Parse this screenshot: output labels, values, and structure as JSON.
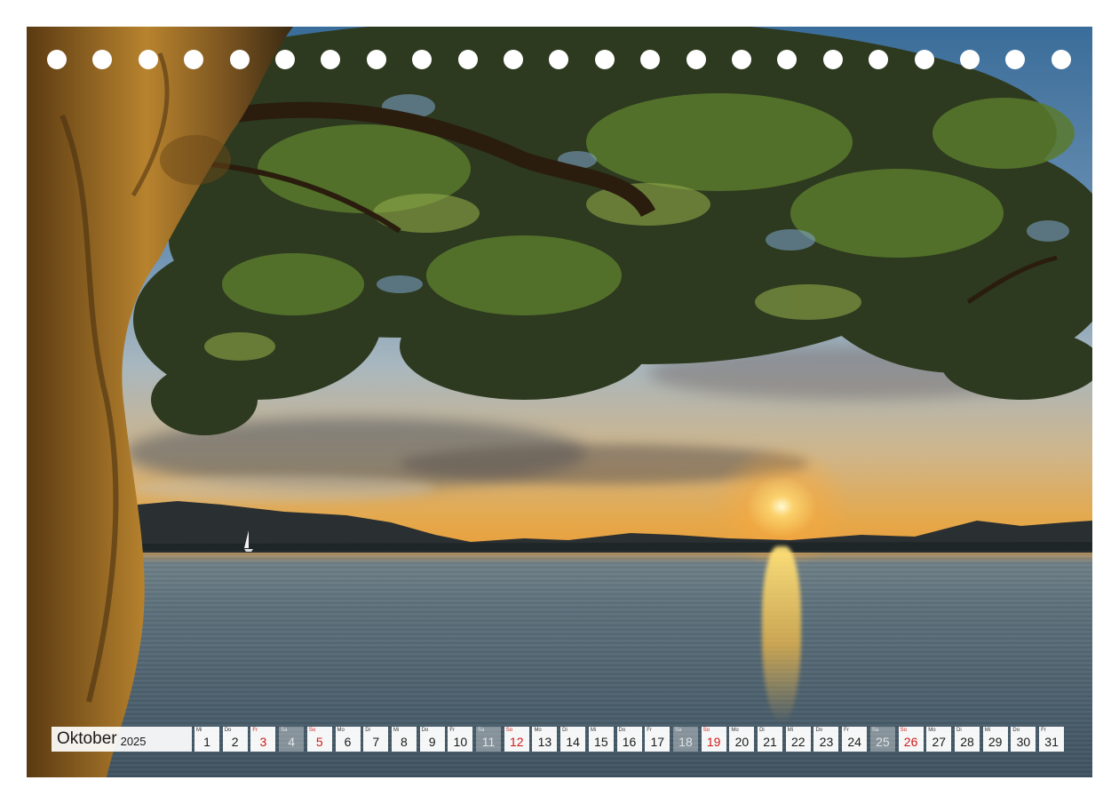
{
  "calendar": {
    "month": "Oktober",
    "year": "2025",
    "colors": {
      "sunday": "#d11a1a",
      "text": "#1a1a1a"
    },
    "days": [
      {
        "dow": "Mi",
        "num": "1",
        "style": "normal"
      },
      {
        "dow": "Do",
        "num": "2",
        "style": "normal"
      },
      {
        "dow": "Fr",
        "num": "3",
        "style": "red"
      },
      {
        "dow": "Sa",
        "num": "4",
        "style": "faded"
      },
      {
        "dow": "So",
        "num": "5",
        "style": "red"
      },
      {
        "dow": "Mo",
        "num": "6",
        "style": "normal"
      },
      {
        "dow": "Di",
        "num": "7",
        "style": "normal"
      },
      {
        "dow": "Mi",
        "num": "8",
        "style": "normal"
      },
      {
        "dow": "Do",
        "num": "9",
        "style": "normal"
      },
      {
        "dow": "Fr",
        "num": "10",
        "style": "normal"
      },
      {
        "dow": "Sa",
        "num": "11",
        "style": "faded"
      },
      {
        "dow": "So",
        "num": "12",
        "style": "red"
      },
      {
        "dow": "Mo",
        "num": "13",
        "style": "normal"
      },
      {
        "dow": "Di",
        "num": "14",
        "style": "normal"
      },
      {
        "dow": "Mi",
        "num": "15",
        "style": "normal"
      },
      {
        "dow": "Do",
        "num": "16",
        "style": "normal"
      },
      {
        "dow": "Fr",
        "num": "17",
        "style": "normal"
      },
      {
        "dow": "Sa",
        "num": "18",
        "style": "faded"
      },
      {
        "dow": "So",
        "num": "19",
        "style": "red"
      },
      {
        "dow": "Mo",
        "num": "20",
        "style": "normal"
      },
      {
        "dow": "Di",
        "num": "21",
        "style": "normal"
      },
      {
        "dow": "Mi",
        "num": "22",
        "style": "normal"
      },
      {
        "dow": "Do",
        "num": "23",
        "style": "normal"
      },
      {
        "dow": "Fr",
        "num": "24",
        "style": "normal"
      },
      {
        "dow": "Sa",
        "num": "25",
        "style": "faded"
      },
      {
        "dow": "So",
        "num": "26",
        "style": "red"
      },
      {
        "dow": "Mo",
        "num": "27",
        "style": "normal"
      },
      {
        "dow": "Di",
        "num": "28",
        "style": "normal"
      },
      {
        "dow": "Mi",
        "num": "29",
        "style": "normal"
      },
      {
        "dow": "Do",
        "num": "30",
        "style": "normal"
      },
      {
        "dow": "Fr",
        "num": "31",
        "style": "normal"
      }
    ]
  }
}
